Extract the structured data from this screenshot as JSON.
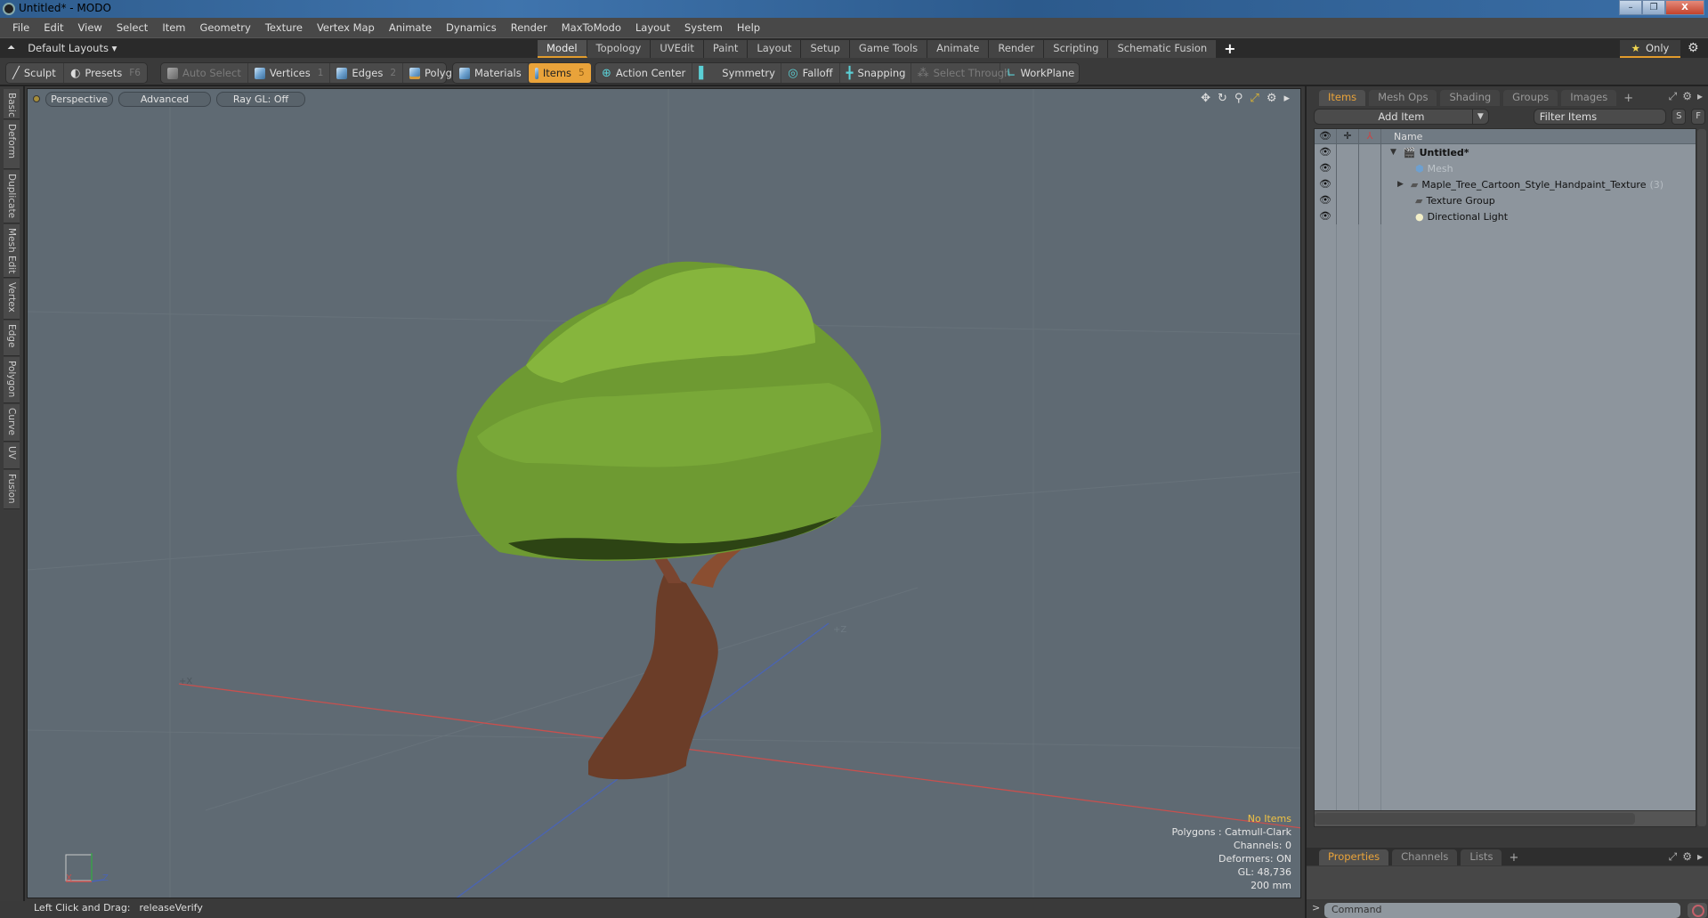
{
  "window": {
    "title": "Untitled* - MODO",
    "controls": {
      "minimize": "–",
      "restore": "❐",
      "close": "X"
    }
  },
  "menu": [
    "File",
    "Edit",
    "View",
    "Select",
    "Item",
    "Geometry",
    "Texture",
    "Vertex Map",
    "Animate",
    "Dynamics",
    "Render",
    "MaxToModo",
    "Layout",
    "System",
    "Help"
  ],
  "layoutbar": {
    "layouts_label": "Default Layouts ▾",
    "tabs": [
      {
        "label": "Model",
        "active": true
      },
      {
        "label": "Topology"
      },
      {
        "label": "UVEdit"
      },
      {
        "label": "Paint"
      },
      {
        "label": "Layout"
      },
      {
        "label": "Setup"
      },
      {
        "label": "Game Tools"
      },
      {
        "label": "Animate"
      },
      {
        "label": "Render"
      },
      {
        "label": "Scripting"
      },
      {
        "label": "Schematic Fusion"
      }
    ],
    "add_tab": "+",
    "only_label": "Only",
    "star": "★",
    "gear": "⚙"
  },
  "toolbar": {
    "sculpt": "Sculpt",
    "presets": "Presets",
    "presets_key": "F6",
    "auto_select": "Auto Select",
    "vertices": "Vertices",
    "vertices_key": "1",
    "edges": "Edges",
    "edges_key": "2",
    "polygons": "Polygons",
    "materials": "Materials",
    "items": "Items",
    "items_key": "5",
    "action_center": "Action Center",
    "symmetry": "Symmetry",
    "falloff": "Falloff",
    "snapping": "Snapping",
    "select_through": "Select Through",
    "workplane": "WorkPlane"
  },
  "left_tabs": [
    "Basic",
    "Deform",
    "Duplicate",
    "Mesh Edit",
    "Vertex",
    "Edge",
    "Polygon",
    "Curve",
    "UV",
    "Fusion"
  ],
  "viewport": {
    "view_mode": "Perspective",
    "shading": "Advanced",
    "raygl": "Ray GL: Off",
    "axis_labels": {
      "x": "+X",
      "z": "+Z"
    },
    "gizmo": {
      "x": "X",
      "z": "Z"
    },
    "hud": {
      "selection": "No Items",
      "polygons": "Polygons : Catmull-Clark",
      "channels": "Channels: 0",
      "deformers": "Deformers: ON",
      "gl": "GL: 48,736",
      "scale": "200 mm"
    },
    "colors": {
      "background": "#5f6a73",
      "x_axis": "#c8504e",
      "z_axis": "#4a64b4",
      "foliage": "#6e9a32",
      "trunk": "#6b3d28"
    }
  },
  "status": {
    "hint": "Left Click and Drag:",
    "command": "releaseVerify"
  },
  "items_panel": {
    "tabs": [
      {
        "label": "Items",
        "active": true
      },
      {
        "label": "Mesh Ops"
      },
      {
        "label": "Shading"
      },
      {
        "label": "Groups"
      },
      {
        "label": "Images"
      }
    ],
    "add_tab": "+",
    "add_item": "Add Item",
    "filter_placeholder": "Filter Items",
    "s_button": "S",
    "f_button": "F",
    "column_name": "Name",
    "tree": [
      {
        "label": "Untitled*",
        "kind": "scene",
        "expanded": true,
        "bold": true
      },
      {
        "label": "Mesh",
        "kind": "mesh",
        "dim": true
      },
      {
        "label": "Maple_Tree_Cartoon_Style_Handpaint_Texture",
        "kind": "group",
        "collapsed": true,
        "count": "(3)"
      },
      {
        "label": "Texture Group",
        "kind": "group"
      },
      {
        "label": "Directional Light",
        "kind": "light"
      }
    ]
  },
  "properties_panel": {
    "tabs": [
      {
        "label": "Properties",
        "active": true
      },
      {
        "label": "Channels"
      },
      {
        "label": "Lists"
      }
    ],
    "add_tab": "+"
  },
  "command_line": {
    "prompt": ">",
    "placeholder": "Command"
  }
}
